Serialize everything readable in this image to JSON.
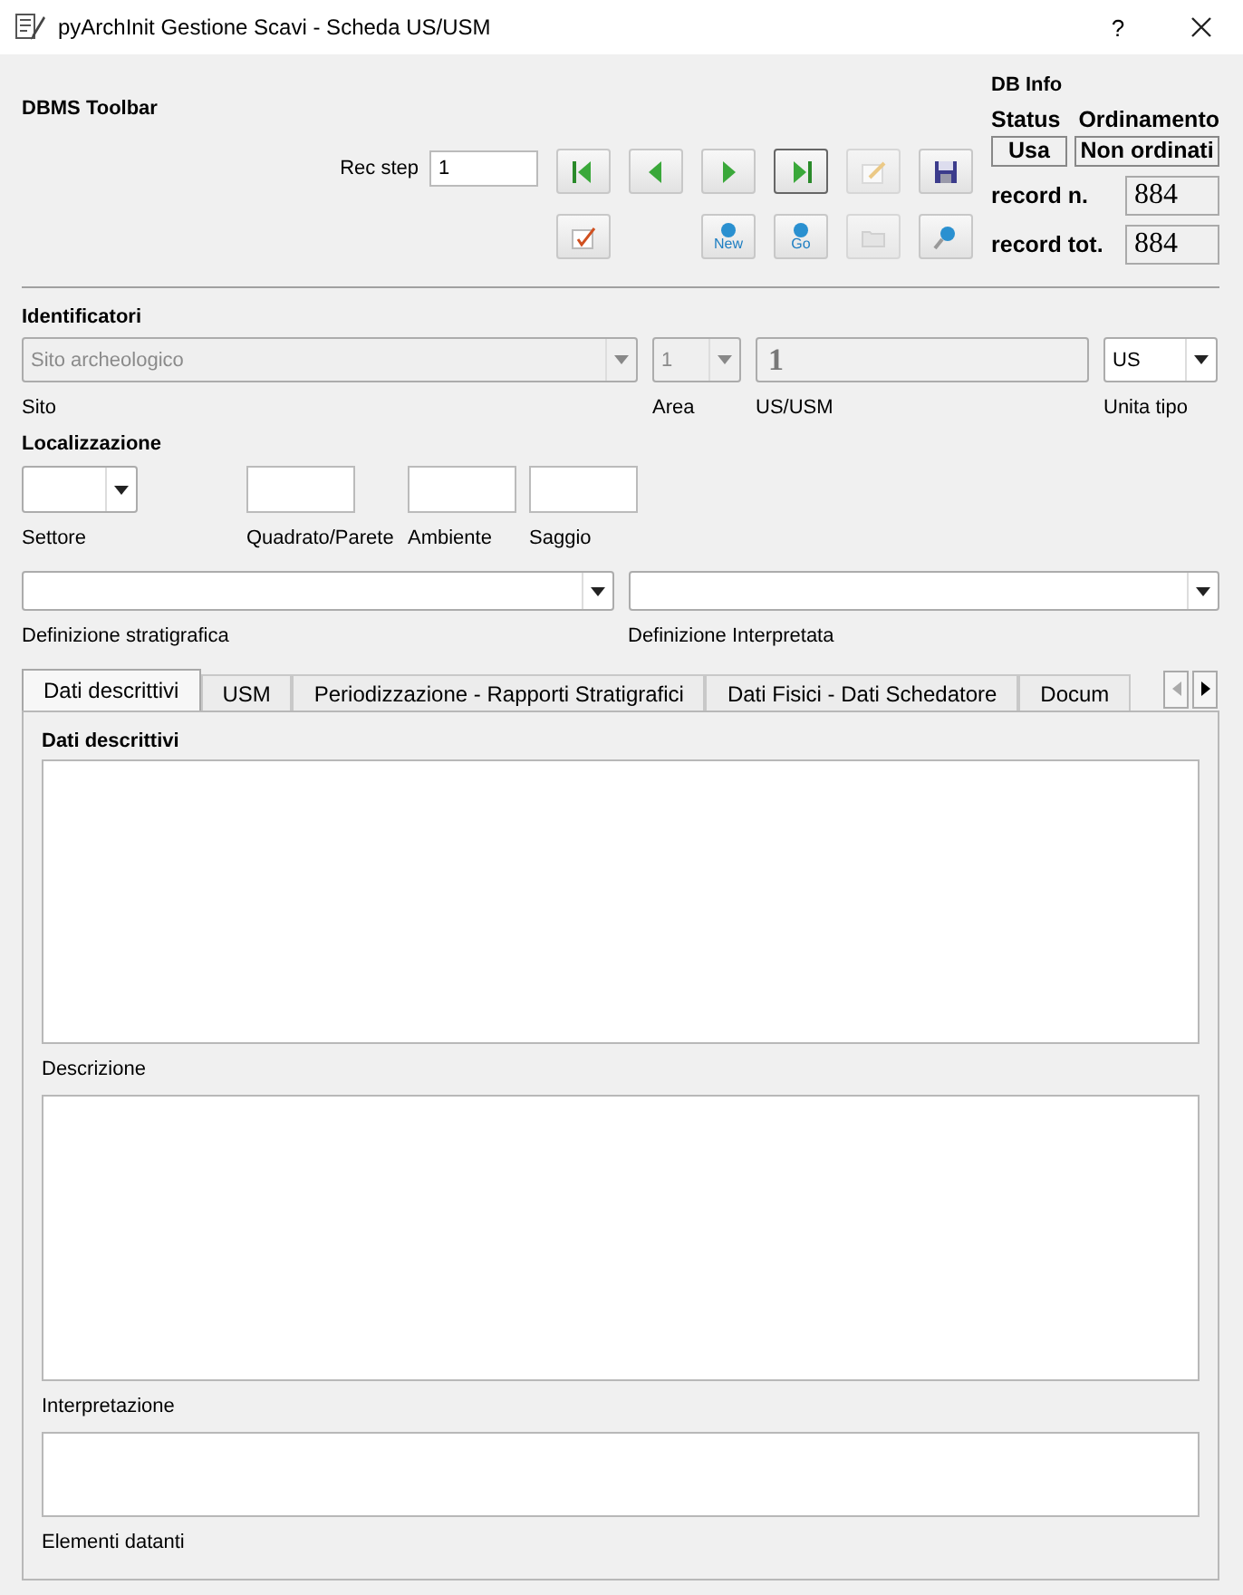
{
  "window": {
    "title": "pyArchInit Gestione Scavi - Scheda US/USM",
    "help": "?"
  },
  "toolbar": {
    "title": "DBMS Toolbar",
    "rec_step_label": "Rec step",
    "rec_step": "1",
    "rows": [
      [
        {
          "kind": "first",
          "disabled": false,
          "focused": false
        },
        {
          "kind": "prev",
          "disabled": false,
          "focused": false
        },
        {
          "kind": "next",
          "disabled": false,
          "focused": false
        },
        {
          "kind": "last",
          "disabled": false,
          "focused": true
        },
        {
          "kind": "edit",
          "disabled": true,
          "focused": false
        },
        {
          "kind": "save",
          "disabled": false,
          "focused": false
        }
      ],
      [
        {
          "kind": "report",
          "disabled": false,
          "focused": false
        },
        {
          "kind": "new",
          "label": "New",
          "disabled": false,
          "focused": false
        },
        {
          "kind": "go",
          "label": "Go",
          "disabled": false,
          "focused": false
        },
        {
          "kind": "folder",
          "disabled": true,
          "focused": false
        },
        {
          "kind": "search",
          "disabled": false,
          "focused": false
        }
      ]
    ]
  },
  "db_info": {
    "title": "DB Info",
    "status_label": "Status",
    "order_label": "Ordinamento",
    "status": "Usa",
    "order": "Non ordinati",
    "record_n_label": "record n.",
    "record_n": "884",
    "record_tot_label": "record tot.",
    "record_tot": "884"
  },
  "identificatori": {
    "title": "Identificatori",
    "sito": {
      "value": "Sito archeologico",
      "label": "Sito",
      "disabled": true
    },
    "area": {
      "value": "1",
      "label": "Area",
      "disabled": true
    },
    "us": {
      "value": "1",
      "label": "US/USM",
      "disabled": true
    },
    "unita_tipo": {
      "value": "US",
      "label": "Unita tipo",
      "disabled": false
    }
  },
  "localizzazione": {
    "title": "Localizzazione",
    "settore": {
      "label": "Settore"
    },
    "quadrato": {
      "label": "Quadrato/Parete"
    },
    "ambiente": {
      "label": "Ambiente"
    },
    "saggio": {
      "label": "Saggio"
    }
  },
  "definizioni": [
    {
      "label": "Definizione stratigrafica"
    },
    {
      "label": "Definizione Interpretata"
    }
  ],
  "tabs": [
    {
      "label": "Dati descrittivi",
      "selected": true
    },
    {
      "label": "USM",
      "selected": false
    },
    {
      "label": "Periodizzazione - Rapporti Stratigrafici",
      "selected": false
    },
    {
      "label": "Dati Fisici - Dati Schedatore",
      "selected": false
    },
    {
      "label": "Docum",
      "selected": false
    }
  ],
  "tab_scroll": {
    "left_disabled": true,
    "right_disabled": false
  },
  "panel": {
    "title": "Dati descrittivi",
    "fields": [
      {
        "label": "Descrizione"
      },
      {
        "label": "Interpretazione"
      },
      {
        "label": "Elementi datanti"
      }
    ]
  }
}
